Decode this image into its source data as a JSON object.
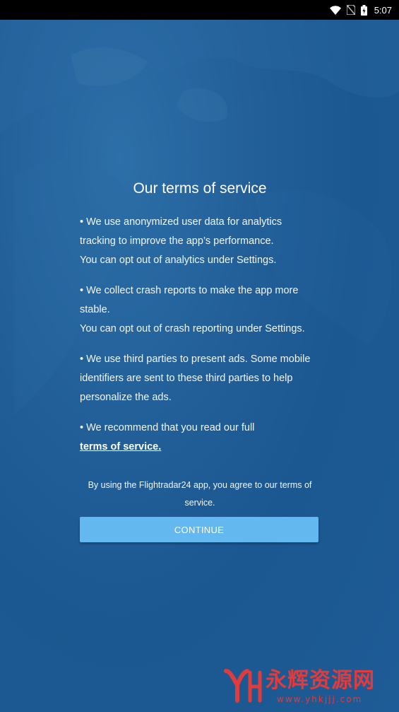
{
  "status_bar": {
    "time": "5:07",
    "icons": [
      "wifi-icon",
      "no-sim-icon",
      "battery-charging-icon"
    ]
  },
  "terms": {
    "title": "Our terms of service",
    "paragraphs": [
      {
        "lines": [
          "• We use anonymized user data for analytics",
          "tracking to improve the app’s performance.",
          "You can opt out of analytics under Settings."
        ]
      },
      {
        "lines": [
          "• We collect crash reports to make the app more",
          "stable.",
          "You can opt out of crash reporting under Settings."
        ]
      },
      {
        "lines": [
          "• We use third parties to present ads. Some mobile",
          "identifiers are sent to these third parties to help",
          "personalize the ads."
        ]
      },
      {
        "lines": [
          "• We recommend that you read our full"
        ],
        "link": "terms of service."
      }
    ],
    "agreement_line1": "By using the Flightradar24 app, you agree to our terms of",
    "agreement_line2": "service.",
    "continue_label": "CONTINUE"
  },
  "watermark": {
    "text": "永辉资源网",
    "url": "www.yhkjjj.com"
  },
  "colors": {
    "background": "#1b5d98",
    "button": "#63b8f0",
    "watermark": "#e23b3b"
  }
}
